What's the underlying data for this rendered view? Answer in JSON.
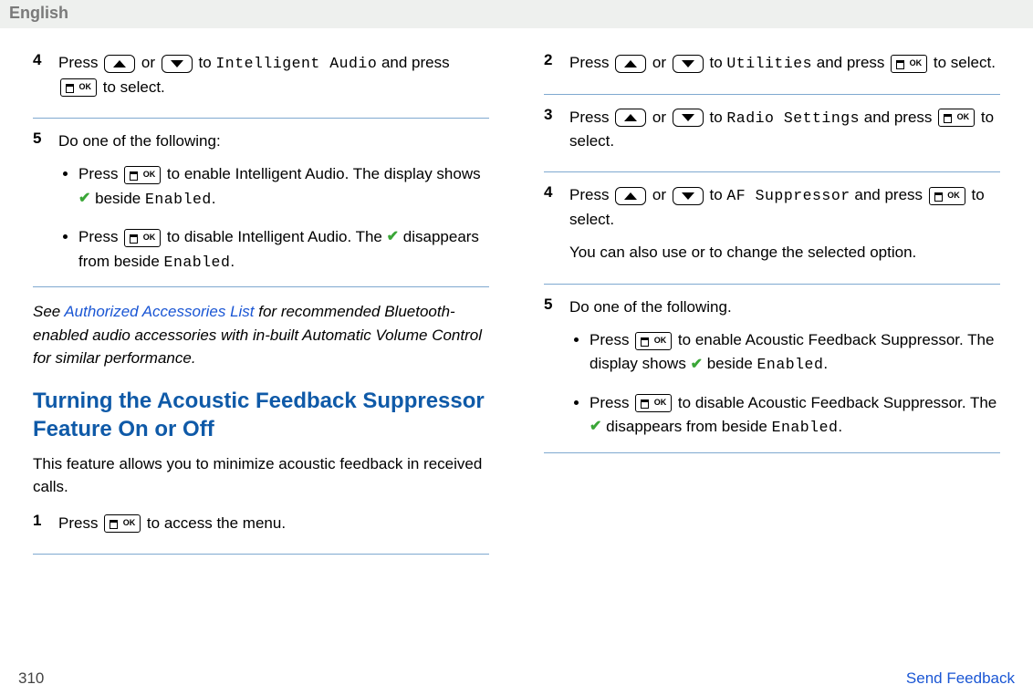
{
  "header": {
    "language": "English"
  },
  "left": {
    "step4": {
      "num": "4",
      "t1": "Press ",
      "t2": " or ",
      "t3": " to ",
      "menu_item": "Intelligent Audio",
      "t4": " and press ",
      "t5": " to select."
    },
    "step5": {
      "num": "5",
      "intro": "Do one of the following:",
      "b1a": "Press ",
      "b1b": " to enable Intelligent Audio. The display shows ",
      "b1c": " beside ",
      "b1_enabled": "Enabled",
      "b1d": ".",
      "b2a": "Press ",
      "b2b": " to disable Intelligent Audio. The ",
      "b2c": " disappears from beside ",
      "b2_enabled": "Enabled",
      "b2d": "."
    },
    "note": {
      "pre": "See ",
      "link": "Authorized Accessories List",
      "post": " for recommended Bluetooth-enabled audio accessories with in-built Automatic Volume Control for similar performance."
    },
    "heading": "Turning the Acoustic Feedback Suppressor Feature On or Off",
    "intro": "This feature allows you to minimize acoustic feedback in received calls.",
    "step1": {
      "num": "1",
      "t1": "Press ",
      "t2": " to access the menu."
    }
  },
  "right": {
    "step2": {
      "num": "2",
      "t1": "Press ",
      "t2": " or ",
      "t3": " to ",
      "menu_item": "Utilities",
      "t4": " and press ",
      "t5": " to select."
    },
    "step3": {
      "num": "3",
      "t1": "Press ",
      "t2": " or ",
      "t3": " to ",
      "menu_item": "Radio Settings",
      "t4": " and press ",
      "t5": " to select."
    },
    "step4": {
      "num": "4",
      "t1": "Press ",
      "t2": " or ",
      "t3": " to ",
      "menu_item": "AF Suppressor",
      "t4": " and press ",
      "t5": " to select.",
      "note": "You can also use or to change the selected option."
    },
    "step5": {
      "num": "5",
      "intro": "Do one of the following.",
      "b1a": "Press ",
      "b1b": " to enable Acoustic Feedback Suppressor. The display shows ",
      "b1c": " beside ",
      "b1_enabled": "Enabled",
      "b1d": ".",
      "b2a": "Press ",
      "b2b": " to disable Acoustic Feedback Suppressor. The ",
      "b2c": " disappears from beside ",
      "b2_enabled": "Enabled",
      "b2d": "."
    }
  },
  "footer": {
    "page": "310",
    "feedback": "Send Feedback"
  }
}
